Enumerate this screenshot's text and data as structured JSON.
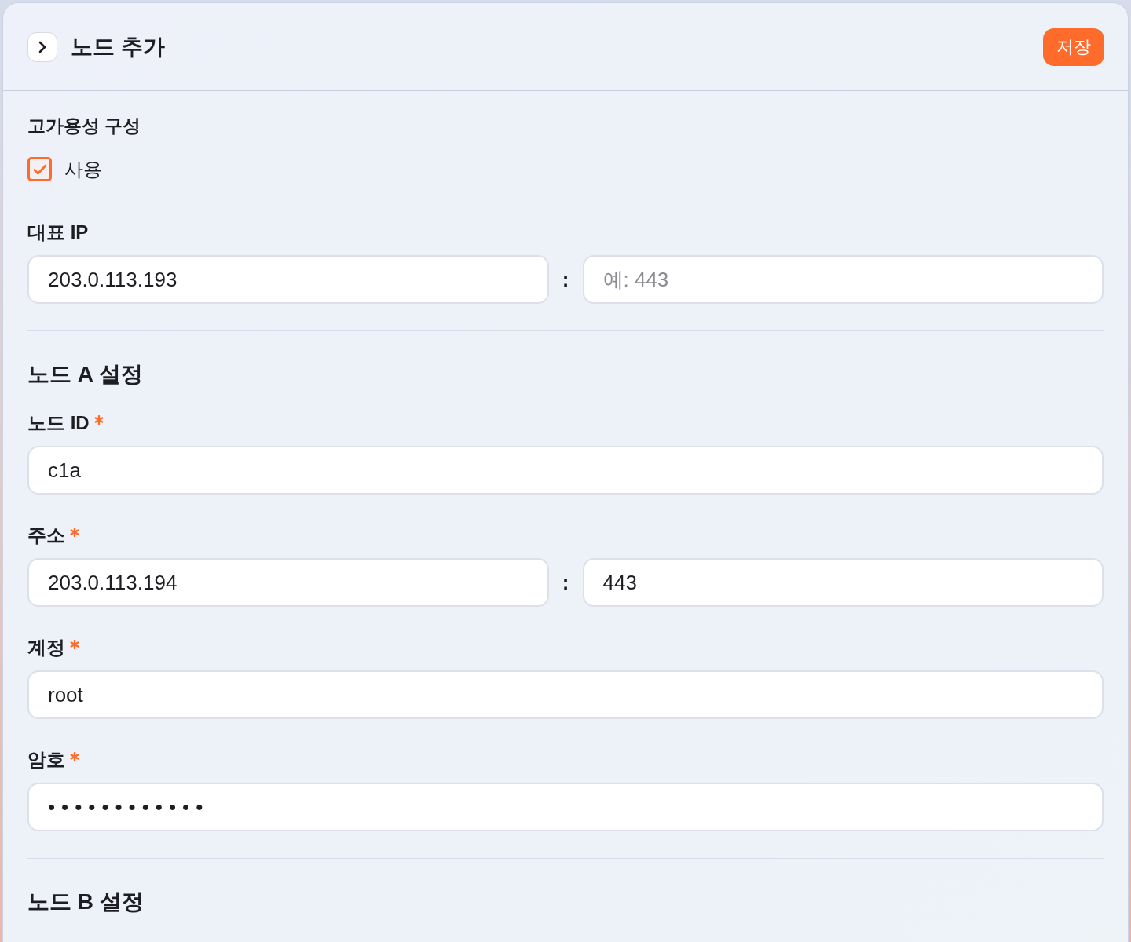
{
  "header": {
    "title": "노드 추가",
    "save_button": "저장"
  },
  "high_availability": {
    "title": "고가용성 구성",
    "checkbox": {
      "label": "사용",
      "checked": true
    }
  },
  "virtual_ip": {
    "kind": "host_port",
    "label": "대표 IP",
    "required": false,
    "host": {
      "value": "203.0.113.193"
    },
    "separator": ":",
    "port": {
      "placeholder": "예: 443"
    }
  },
  "node_sections": [
    {
      "title": "노드 A 설정",
      "fields": [
        {
          "kind": "text",
          "label": "노드 ID",
          "required": true,
          "value": "c1a"
        },
        {
          "kind": "host_port",
          "label": "주소",
          "required": true,
          "host": {
            "value": "203.0.113.194"
          },
          "separator": ":",
          "port": {
            "value": "443"
          }
        },
        {
          "kind": "text",
          "label": "계정",
          "required": true,
          "value": "root"
        },
        {
          "kind": "password",
          "label": "암호",
          "required": true,
          "value": "••••••••••••"
        }
      ]
    },
    {
      "title": "노드 B 설정"
    }
  ]
}
